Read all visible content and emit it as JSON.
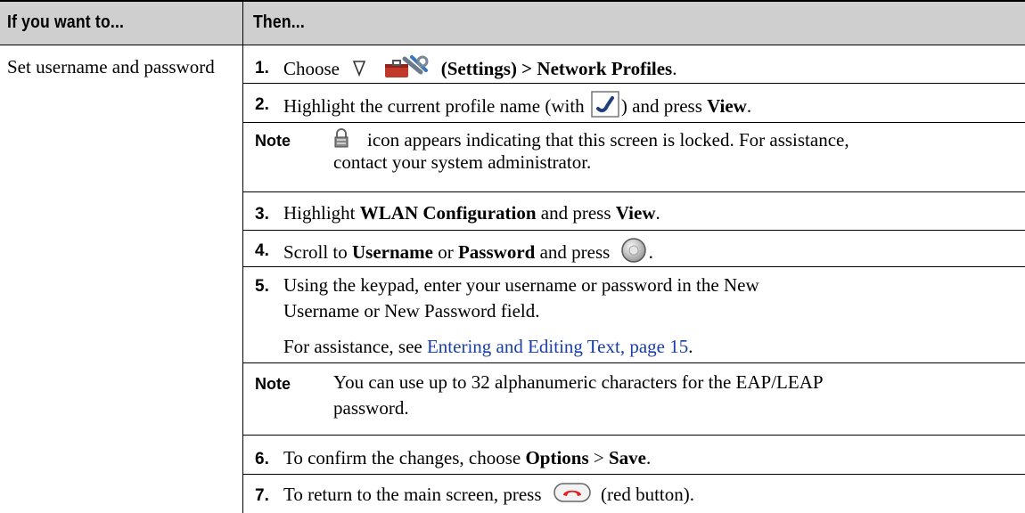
{
  "header": {
    "col1": "If you want to...",
    "col2": "Then..."
  },
  "task": "Set username and password",
  "steps": {
    "s1": {
      "num": "1.",
      "pre": "Choose",
      "mid": "(",
      "bold1": "Settings",
      "mid2": ") > ",
      "bold2": "Network Profiles",
      "post": "."
    },
    "s2": {
      "num": "2.",
      "pre": "Highlight the current profile name (with",
      "mid": ") and press",
      "bold": "View",
      "post": "."
    },
    "note1": {
      "label": "Note",
      "line1": "icon appears indicating that this screen is locked. For assistance,",
      "line2": "contact your system administrator."
    },
    "s3": {
      "num": "3.",
      "pre": "Highlight",
      "bold": "WLAN Configuration",
      "mid": "and press",
      "bold2": "View",
      "post": "."
    },
    "s4": {
      "num": "4.",
      "pre": "Scroll to",
      "bold": "Username",
      "mid": "or",
      "bold2": "Password",
      "mid2": "and press",
      "post": "."
    },
    "s5": {
      "num": "5.",
      "line1": "Using the keypad, enter your username or password in the New",
      "line2": "Username or New Password field."
    },
    "s5b": {
      "pre": "For assistance, see",
      "link": "Entering and Editing Text, page 15",
      "post": "."
    },
    "note2": {
      "label": "Note",
      "line1": "You can use up to 32 alphanumeric characters for the EAP/LEAP",
      "line2": "password."
    },
    "s6": {
      "num": "6.",
      "pre": "To confirm the changes, choose",
      "bold": "Options",
      "mid": ">",
      "bold2": "Save",
      "post": "."
    },
    "s7": {
      "num": "7.",
      "pre": "To return to the main screen, press",
      "post": "(red button)."
    }
  },
  "icons": {
    "nav": "navigation-arrow-icon",
    "settings": "settings-toolbox-icon",
    "profile": "active-profile-checkmark-icon",
    "lock": "lock-icon",
    "select": "select-button-icon",
    "end": "red-end-call-button-icon"
  },
  "colors": {
    "header_bg": "#cfcfcf",
    "link": "#1a3ea8",
    "end_button": "#e02020"
  }
}
